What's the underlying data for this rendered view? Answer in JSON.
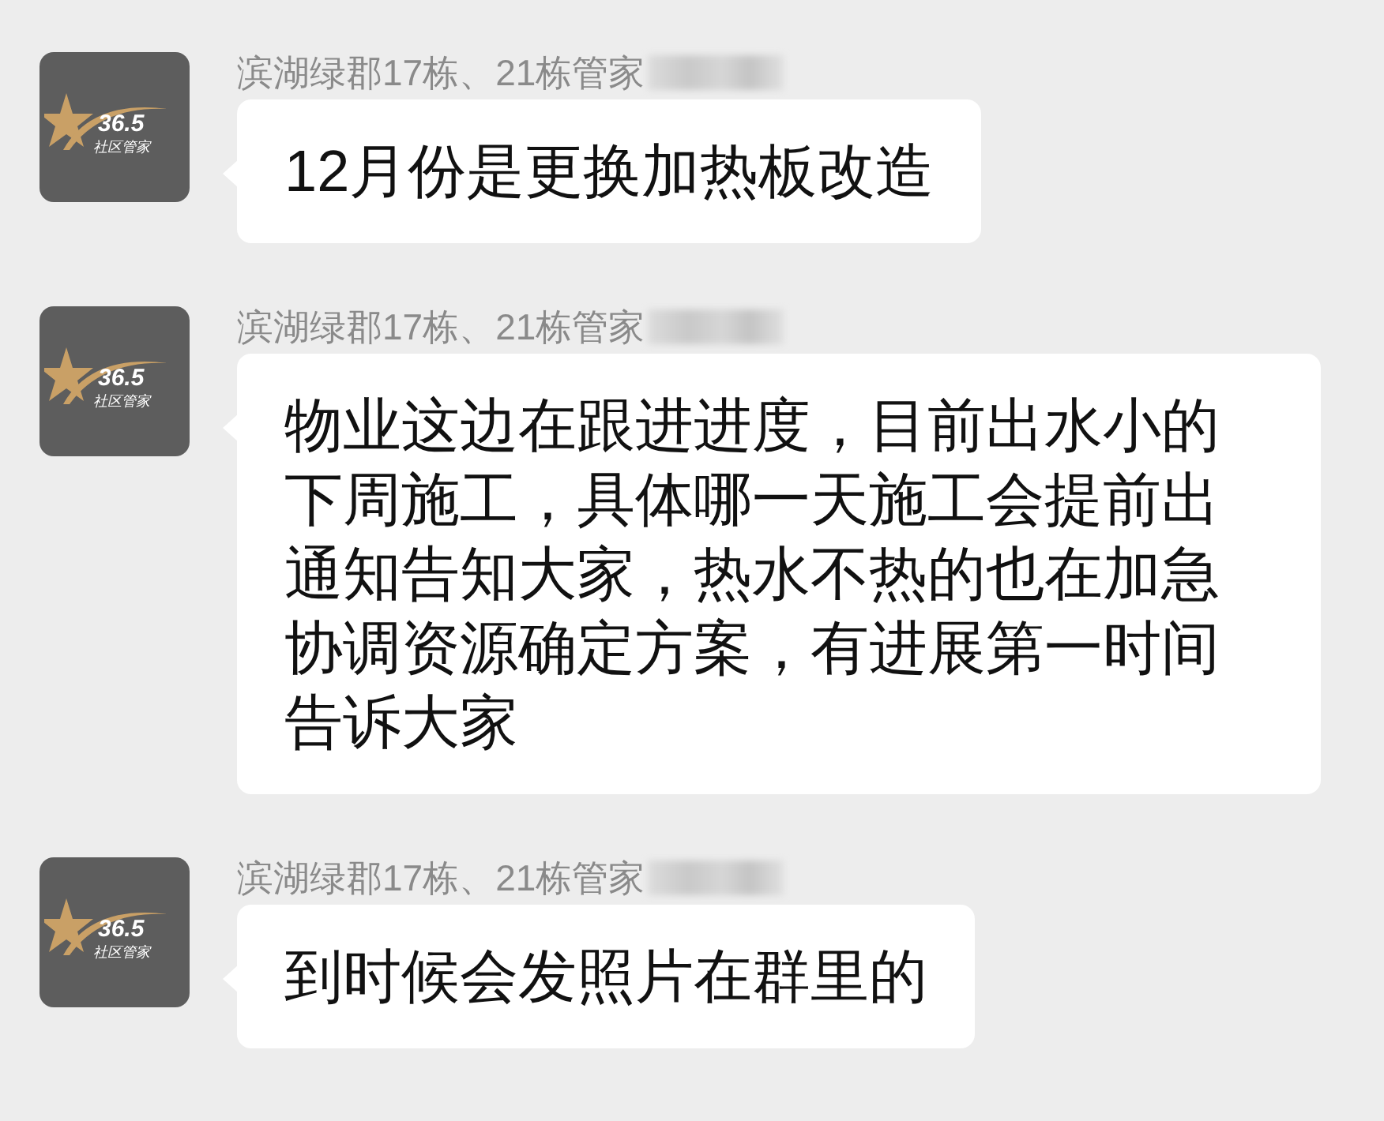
{
  "messages": [
    {
      "sender": "滨湖绿郡17栋、21栋管家",
      "avatar": {
        "number": "36.5",
        "caption": "社区管家"
      },
      "text": "12月份是更换加热板改造"
    },
    {
      "sender": "滨湖绿郡17栋、21栋管家",
      "avatar": {
        "number": "36.5",
        "caption": "社区管家"
      },
      "text": "物业这边在跟进进度，目前出水小的下周施工，具体哪一天施工会提前出通知告知大家，热水不热的也在加急协调资源确定方案，有进展第一时间告诉大家"
    },
    {
      "sender": "滨湖绿郡17栋、21栋管家",
      "avatar": {
        "number": "36.5",
        "caption": "社区管家"
      },
      "text": "到时候会发照片在群里的"
    }
  ]
}
